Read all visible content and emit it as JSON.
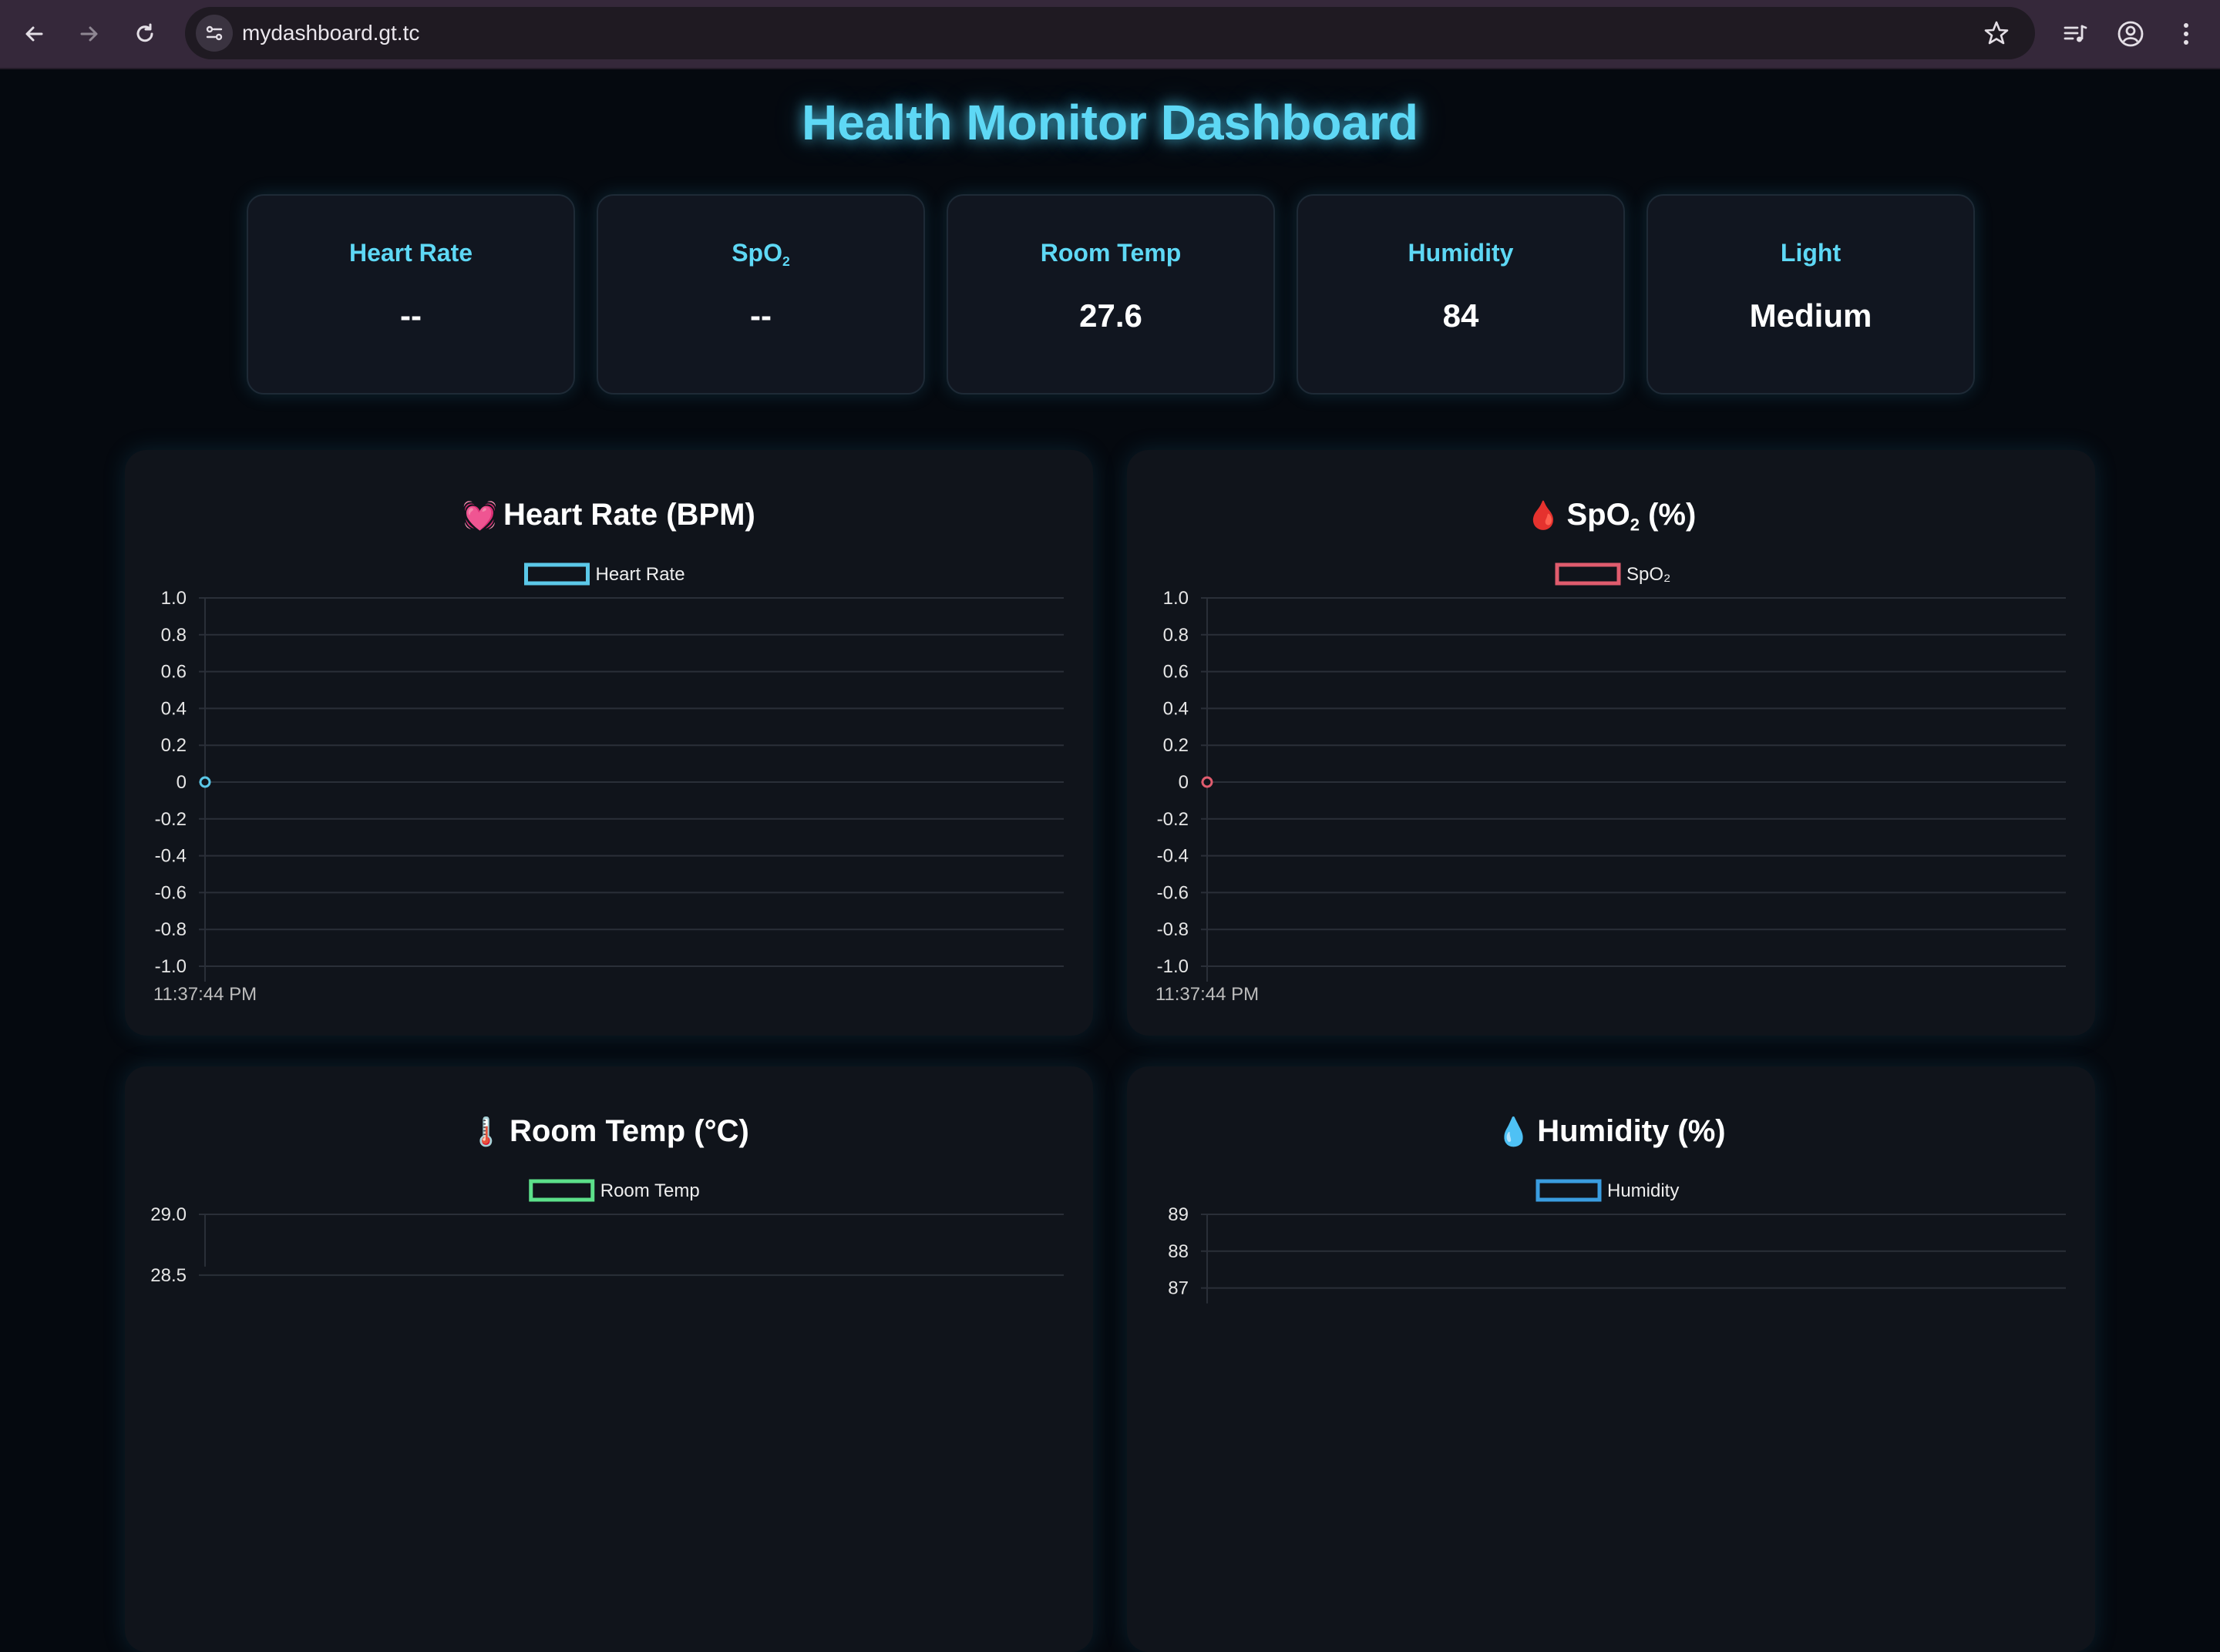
{
  "browser": {
    "url": "mydashboard.gt.tc",
    "icons": [
      "back-arrow-icon",
      "forward-arrow-icon",
      "reload-icon",
      "site-settings-icon",
      "star-icon",
      "media-control-icon",
      "profile-icon",
      "more-menu-icon"
    ]
  },
  "page": {
    "title": "Health Monitor Dashboard"
  },
  "stats": [
    {
      "label": "Heart Rate",
      "value": "--"
    },
    {
      "label": "SpO",
      "label_sub": "2",
      "value": "--"
    },
    {
      "label": "Room Temp",
      "value": "27.6"
    },
    {
      "label": "Humidity",
      "value": "84"
    },
    {
      "label": "Light",
      "value": "Medium"
    }
  ],
  "charts": [
    {
      "emoji": "💓",
      "title": "Heart Rate (BPM)",
      "legend": "Heart Rate"
    },
    {
      "emoji": "🩸",
      "title": "SpO",
      "title_sub": "2",
      "title_suffix": " (%)",
      "legend": "SpO₂"
    },
    {
      "emoji": "🌡️",
      "title": "Room Temp (°C)",
      "legend": "Room Temp"
    },
    {
      "emoji": "💧",
      "title": "Humidity (%)",
      "legend": "Humidity"
    }
  ],
  "chart_data": [
    {
      "type": "line",
      "title": "Heart Rate (BPM)",
      "series": [
        {
          "name": "Heart Rate",
          "color": "#5bc8e8",
          "x": [
            "11:37:44 PM"
          ],
          "values": [
            0
          ]
        }
      ],
      "ylim": [
        -1.0,
        1.0
      ],
      "yticks": [
        "1.0",
        "0.8",
        "0.6",
        "0.4",
        "0.2",
        "0",
        "-0.2",
        "-0.4",
        "-0.6",
        "-0.8",
        "-1.0"
      ],
      "xticks": [
        "11:37:44 PM"
      ],
      "grid": true,
      "legend": "top-center"
    },
    {
      "type": "line",
      "title": "SpO₂ (%)",
      "series": [
        {
          "name": "SpO₂",
          "color": "#e05c6e",
          "x": [
            "11:37:44 PM"
          ],
          "values": [
            0
          ]
        }
      ],
      "ylim": [
        -1.0,
        1.0
      ],
      "yticks": [
        "1.0",
        "0.8",
        "0.6",
        "0.4",
        "0.2",
        "0",
        "-0.2",
        "-0.4",
        "-0.6",
        "-0.8",
        "-1.0"
      ],
      "xticks": [
        "11:37:44 PM"
      ],
      "grid": true,
      "legend": "top-center"
    },
    {
      "type": "line",
      "title": "Room Temp (°C)",
      "series": [
        {
          "name": "Room Temp",
          "color": "#5ce08a",
          "x": [],
          "values": []
        }
      ],
      "yticks": [
        "29.0",
        "28.5"
      ],
      "grid": true,
      "legend": "top-center"
    },
    {
      "type": "line",
      "title": "Humidity (%)",
      "series": [
        {
          "name": "Humidity",
          "color": "#3a9de0",
          "x": [],
          "values": []
        }
      ],
      "yticks": [
        "89",
        "88",
        "87"
      ],
      "grid": true,
      "legend": "top-center"
    }
  ]
}
